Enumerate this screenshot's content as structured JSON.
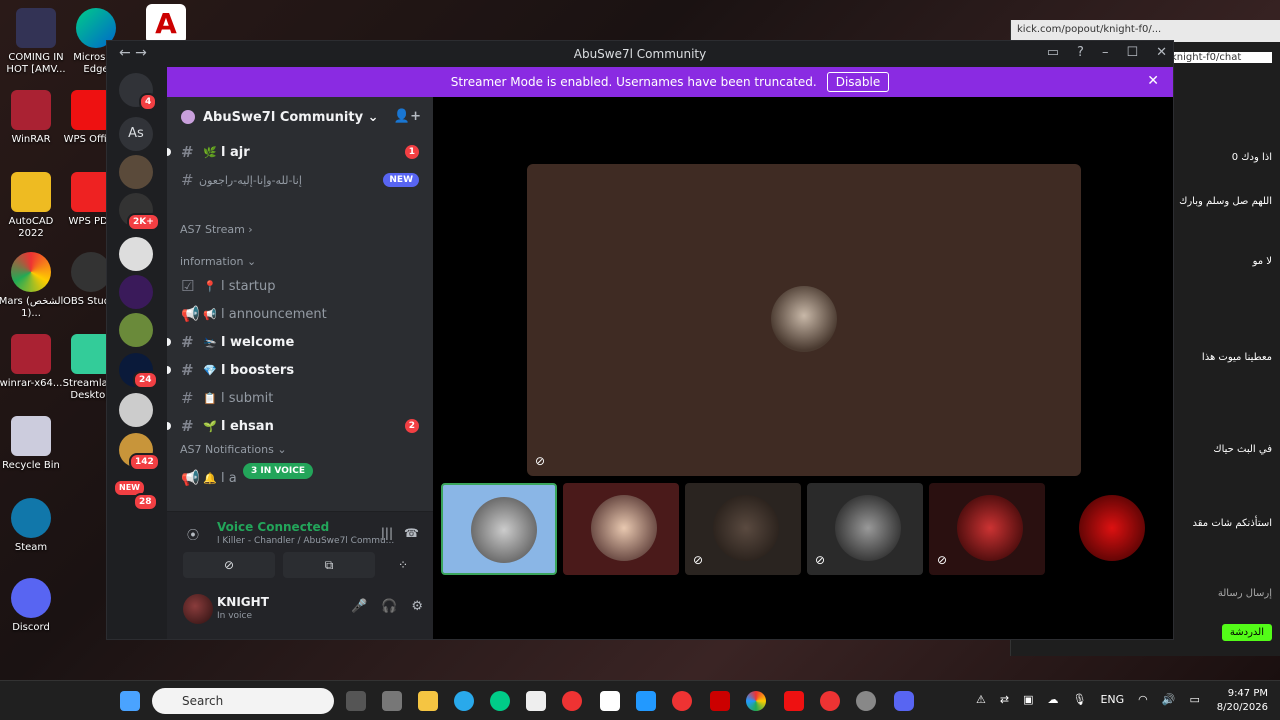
{
  "desktop_icons": [
    {
      "label": "COMING IN HOT [AMV..."
    },
    {
      "label": "Microsoft Edge"
    },
    {
      "label": "WinRAR"
    },
    {
      "label": "WPS Office"
    },
    {
      "label": "AutoCAD 2022"
    },
    {
      "label": "WPS PDF"
    },
    {
      "label": "Mars (الشخص 1)..."
    },
    {
      "label": "OBS Studio"
    },
    {
      "label": "winrar-x64..."
    },
    {
      "label": "Streamlabs Desktop"
    },
    {
      "label": "Recycle Bin"
    },
    {
      "label": "Steam"
    },
    {
      "label": "Discord"
    }
  ],
  "browser_bg": {
    "url": "kick.com/popout/knight-f0/...",
    "tab_url": "knight-f0/chat",
    "lines": [
      "اذا ودك 0",
      "اللهم صل وسلم وبارك",
      "لا مو",
      "معطينا ميوت هذا",
      "في البث حياك",
      "استأذنكم شات مقد",
      "إرسال رسالة",
      "الدردشة"
    ]
  },
  "window": {
    "title": "AbuSwe7l Community"
  },
  "banner": {
    "text": "Streamer Mode is enabled. Usernames have been truncated.",
    "button": "Disable"
  },
  "guild_badges": [
    "4",
    "2K+",
    "24",
    "142",
    "NEW",
    "28"
  ],
  "guild_as": "As",
  "server": {
    "name": "AbuSwe7l Community"
  },
  "channels": [
    {
      "name": "l ajr",
      "badge": "1"
    },
    {
      "name": "إنا-لله-وإنا-إليه-راجعون",
      "badge": "NEW"
    }
  ],
  "categories": {
    "stream": "AS7 Stream",
    "information": "information",
    "notifications": "AS7 Notifications"
  },
  "info_channels": [
    {
      "name": "l startup"
    },
    {
      "name": "l announcement"
    },
    {
      "name": "l welcome"
    },
    {
      "name": "l boosters"
    },
    {
      "name": "l submit"
    },
    {
      "name": "l ehsan",
      "badge": "2"
    }
  ],
  "notif_channel": "l a",
  "in_voice": "3 IN VOICE",
  "voice": {
    "status": "Voice Connected",
    "channel": "l Killer - Chandler / AbuSwe7l Commu..."
  },
  "user": {
    "name": "KNIGHT",
    "status": "In voice"
  },
  "taskbar": {
    "search": "Search",
    "lang": "ENG",
    "time": "9:47 PM",
    "date": "8/20/2026"
  },
  "colors": {
    "accent": "#8a2be2",
    "green": "#23a55a",
    "red": "#f23f43"
  }
}
